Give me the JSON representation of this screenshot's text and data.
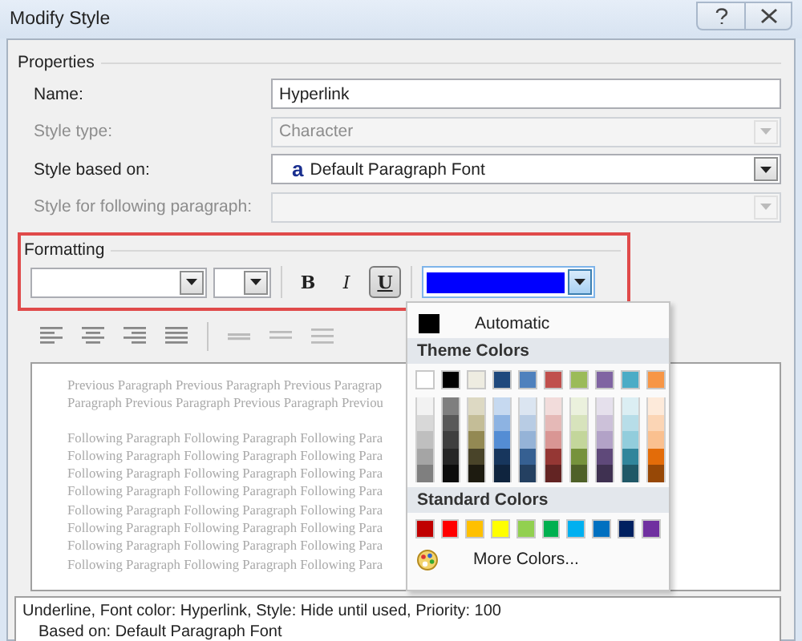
{
  "window": {
    "title": "Modify Style"
  },
  "properties": {
    "title": "Properties",
    "fields": [
      {
        "label": "Name:",
        "value": "Hyperlink",
        "kind": "text",
        "disabled": false
      },
      {
        "label": "Style type:",
        "value": "Character",
        "kind": "dropdown",
        "disabled": true
      },
      {
        "label": "Style based on:",
        "value": "Default Paragraph Font",
        "icon_text": "a",
        "kind": "dropdown",
        "disabled": false
      },
      {
        "label": "Style for following paragraph:",
        "kind": "dropdown",
        "disabled": true
      }
    ]
  },
  "formatting": {
    "title": "Formatting",
    "highlighted": true,
    "font_color": {
      "color": "#0000ff"
    },
    "style_buttons": [
      {
        "label": "B",
        "kind": "bold",
        "pressed": false
      },
      {
        "label": "I",
        "kind": "italic",
        "pressed": false
      },
      {
        "label": "U",
        "kind": "underline",
        "pressed": true
      }
    ],
    "paragraph_tools": [
      {
        "kind": "align-left"
      },
      {
        "kind": "align-center"
      },
      {
        "kind": "align-right"
      },
      {
        "kind": "justify"
      },
      {
        "kind": "single-spacing"
      },
      {
        "kind": "one-half-spacing"
      },
      {
        "kind": "double-spacing"
      }
    ]
  },
  "preview": {
    "previous_lines": [
      "Previous Paragraph Previous Paragraph Previous Paragrap",
      "Paragraph Previous Paragraph Previous Paragraph Previou"
    ],
    "following_lines": [
      "Following Paragraph Following Paragraph Following Para",
      "Following Paragraph Following Paragraph Following Para",
      "Following Paragraph Following Paragraph Following Para",
      "Following Paragraph Following Paragraph Following Para",
      "Following Paragraph Following Paragraph Following Para",
      "Following Paragraph Following Paragraph Following Para",
      "Following Paragraph Following Paragraph Following Para",
      "Following Paragraph Following Paragraph Following Para"
    ]
  },
  "description": [
    "Underline, Font color: Hyperlink, Style: Hide until used, Priority: 100",
    "Based on: Default Paragraph Font"
  ],
  "color_menu": {
    "automatic": {
      "label": "Automatic",
      "color": "#000000"
    },
    "theme_title": "Theme Colors",
    "theme_colors": [
      {
        "color": "#ffffff",
        "shades": [
          {
            "color": "#f2f2f2"
          },
          {
            "color": "#d8d8d8"
          },
          {
            "color": "#bfbfbf"
          },
          {
            "color": "#a5a5a5"
          },
          {
            "color": "#7f7f7f"
          }
        ]
      },
      {
        "color": "#000000",
        "shades": [
          {
            "color": "#7f7f7f"
          },
          {
            "color": "#595959"
          },
          {
            "color": "#3f3f3f"
          },
          {
            "color": "#262626"
          },
          {
            "color": "#0c0c0c"
          }
        ]
      },
      {
        "color": "#eeece1",
        "shades": [
          {
            "color": "#ddd9c3"
          },
          {
            "color": "#c4bd97"
          },
          {
            "color": "#938953"
          },
          {
            "color": "#494429"
          },
          {
            "color": "#1d1b10"
          }
        ]
      },
      {
        "color": "#1f497d",
        "shades": [
          {
            "color": "#c6d9f0"
          },
          {
            "color": "#8db3e2"
          },
          {
            "color": "#548dd4"
          },
          {
            "color": "#17365d"
          },
          {
            "color": "#0f243e"
          }
        ]
      },
      {
        "color": "#4f81bd",
        "shades": [
          {
            "color": "#dbe5f1"
          },
          {
            "color": "#b8cce4"
          },
          {
            "color": "#95b3d7"
          },
          {
            "color": "#366092"
          },
          {
            "color": "#244061"
          }
        ]
      },
      {
        "color": "#c0504d",
        "shades": [
          {
            "color": "#f2dcdb"
          },
          {
            "color": "#e5b9b7"
          },
          {
            "color": "#d99694"
          },
          {
            "color": "#953734"
          },
          {
            "color": "#632423"
          }
        ]
      },
      {
        "color": "#9bbb59",
        "shades": [
          {
            "color": "#ebf1dd"
          },
          {
            "color": "#d7e3bc"
          },
          {
            "color": "#c3d69b"
          },
          {
            "color": "#76923c"
          },
          {
            "color": "#4f6128"
          }
        ]
      },
      {
        "color": "#8064a2",
        "shades": [
          {
            "color": "#e5e0ec"
          },
          {
            "color": "#ccc1d9"
          },
          {
            "color": "#b2a2c7"
          },
          {
            "color": "#5f497a"
          },
          {
            "color": "#3f3151"
          }
        ]
      },
      {
        "color": "#4bacc6",
        "shades": [
          {
            "color": "#dbeef3"
          },
          {
            "color": "#b7dde8"
          },
          {
            "color": "#92cddc"
          },
          {
            "color": "#31859b"
          },
          {
            "color": "#205867"
          }
        ]
      },
      {
        "color": "#f79646",
        "shades": [
          {
            "color": "#fdeada"
          },
          {
            "color": "#fbd5b5"
          },
          {
            "color": "#fac08f"
          },
          {
            "color": "#e36c09"
          },
          {
            "color": "#974806"
          }
        ]
      }
    ],
    "standard_title": "Standard Colors",
    "standard_colors": [
      {
        "color": "#c00000"
      },
      {
        "color": "#ff0000"
      },
      {
        "color": "#ffc000"
      },
      {
        "color": "#ffff00"
      },
      {
        "color": "#92d050"
      },
      {
        "color": "#00b050"
      },
      {
        "color": "#00b0f0"
      },
      {
        "color": "#0070c0"
      },
      {
        "color": "#002060"
      },
      {
        "color": "#7030a0"
      }
    ],
    "more": "More Colors..."
  }
}
